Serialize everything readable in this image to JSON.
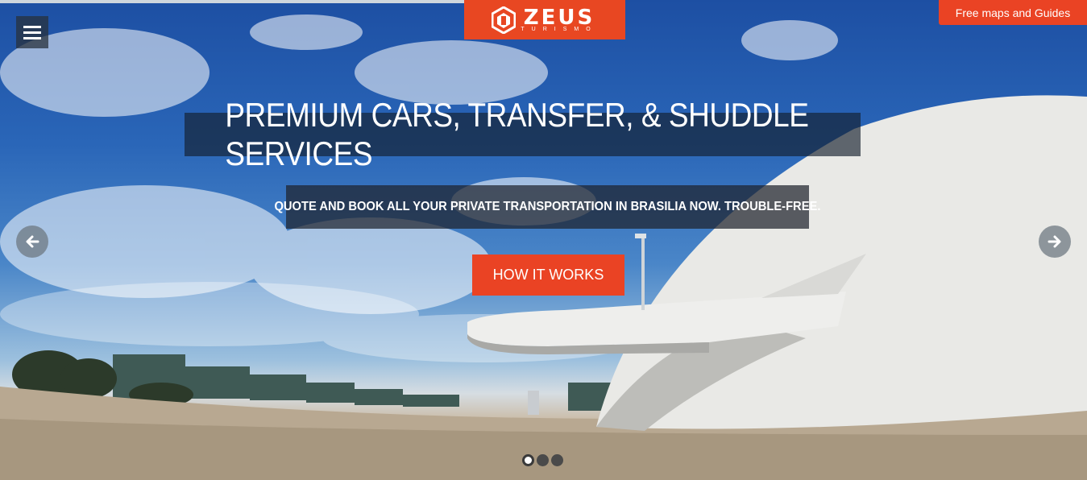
{
  "header": {
    "logo_text": "ZEUS",
    "logo_subtext": "TURISMO",
    "menu_icon": "hamburger-icon",
    "top_cta_label": "Free maps and Guides"
  },
  "hero": {
    "headline": "PREMIUM CARS, TRANSFER, & SHUDDLE SERVICES",
    "subheadline": "QUOTE AND BOOK ALL YOUR PRIVATE TRANSPORTATION IN BRASILIA NOW. TROUBLE-FREE.",
    "button_label": "HOW IT WORKS",
    "prev_icon": "arrow-left-icon",
    "next_icon": "arrow-right-icon",
    "slides_total": 3,
    "active_slide": 1
  },
  "colors": {
    "accent": "#ea4324",
    "overlay": "#141e2d"
  }
}
